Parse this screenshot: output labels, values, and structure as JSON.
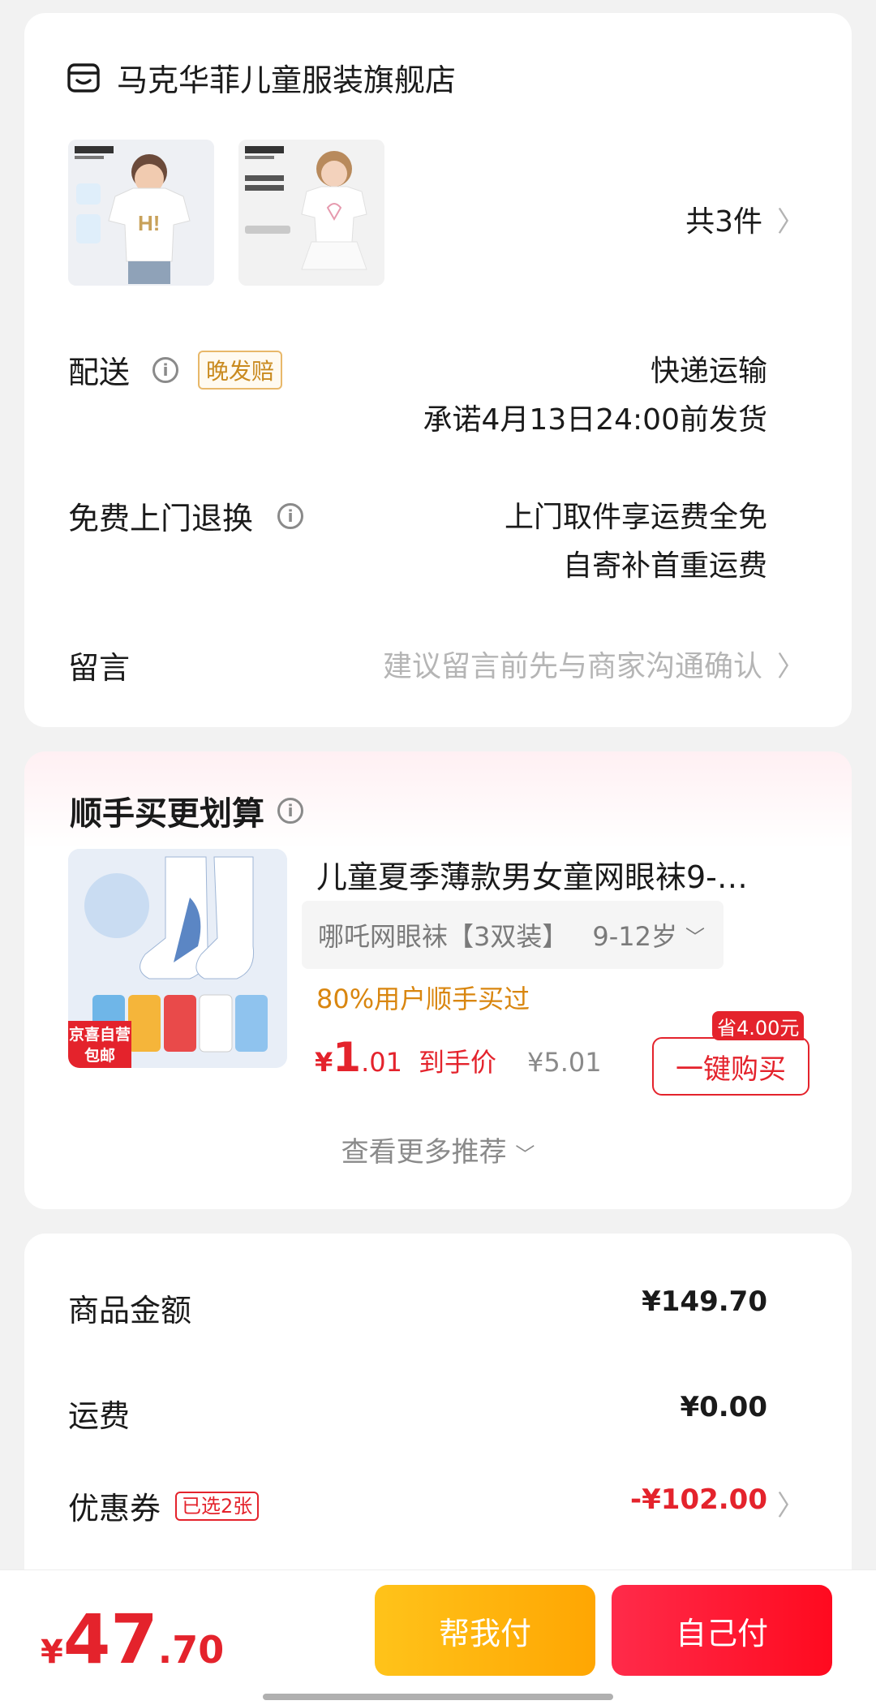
{
  "store": {
    "name": "马克华菲儿童服装旗舰店",
    "quantity": "共3件",
    "delivery_label": "配送",
    "late_badge": "晚发赔",
    "delivery_method": "快递运输",
    "delivery_promise": "承诺4月13日24:00前发货",
    "return_label": "免费上门退换",
    "return_line1": "上门取件享运费全免",
    "return_line2": "自寄补首重运费",
    "message_label": "留言",
    "message_placeholder": "建议留言前先与商家沟通确认"
  },
  "recommend": {
    "title": "顺手买更划算",
    "product_name": "儿童夏季薄款男女童网眼袜9-…",
    "sku": "哪吒网眼袜【3双装】",
    "sku_age": "9-12岁",
    "social_proof": "80%用户顺手买过",
    "price_symbol": "¥",
    "price_int": "1",
    "price_dec": ".01",
    "price_label": "到手价",
    "original_price": "¥5.01",
    "save_badge": "省4.00元",
    "buy_button": "一键购买",
    "tag": "京喜自营 包邮",
    "more": "查看更多推荐"
  },
  "summary": {
    "goods_label": "商品金额",
    "goods_value": "¥149.70",
    "shipping_label": "运费",
    "shipping_value": "¥0.00",
    "coupon_label": "优惠券",
    "coupon_badge": "已选2张",
    "coupon_value": "-¥102.00"
  },
  "bottom": {
    "total_symbol": "¥",
    "total_int": "47",
    "total_dec": ".70",
    "help_pay": "帮我付",
    "self_pay": "自己付"
  },
  "colors": {
    "accent_red": "#e4232c",
    "accent_orange": "#d9860f",
    "help_pay_yellow": "#ffb40d"
  }
}
